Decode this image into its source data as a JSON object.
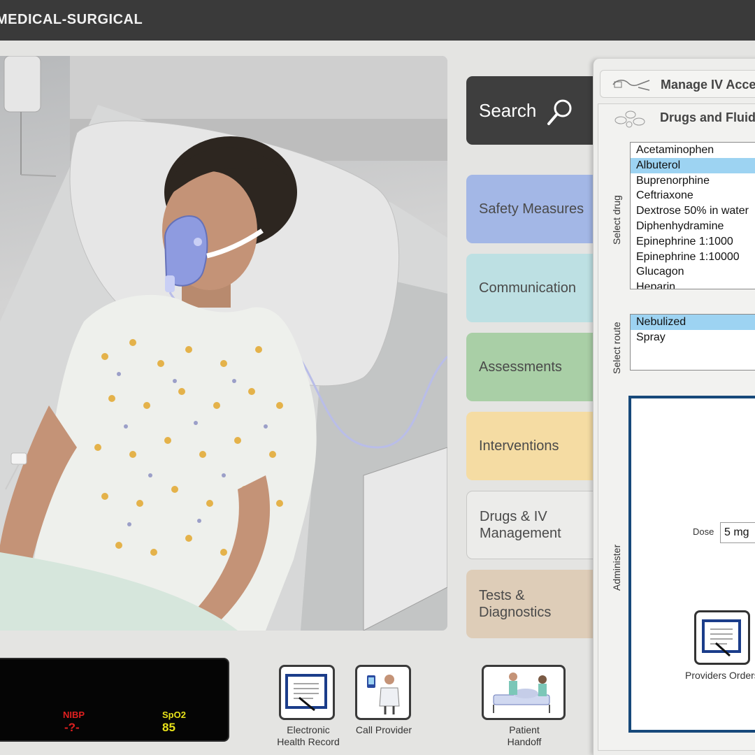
{
  "header": {
    "title": "MEDICAL-SURGICAL"
  },
  "nav": {
    "search_label": "Search",
    "tabs": [
      {
        "label": "Safety Measures",
        "color": "#a3b7e6"
      },
      {
        "label": "Communication",
        "color": "#bde0e3"
      },
      {
        "label": "Assessments",
        "color": "#a9cfa6"
      },
      {
        "label": "Interventions",
        "color": "#f5dca3"
      },
      {
        "label": "Drugs & IV\nManagement",
        "color": "#ececea"
      },
      {
        "label": "Tests &\nDiagnostics",
        "color": "#decdb8"
      }
    ]
  },
  "panel": {
    "manage_iv_label": "Manage IV Access",
    "drugs_fluids_label": "Drugs and Fluids",
    "select_drug_label": "Select drug",
    "drugs": [
      "Acetaminophen",
      "Albuterol",
      "Buprenorphine",
      "Ceftriaxone",
      "Dextrose 50% in water",
      "Diphenhydramine",
      "Epinephrine 1:1000",
      "Epinephrine 1:10000",
      "Glucagon",
      "Heparin"
    ],
    "selected_drug": "Albuterol",
    "select_route_label": "Select route",
    "routes": [
      "Nebulized",
      "Spray"
    ],
    "selected_route": "Nebulized",
    "administer_label": "Administer",
    "dose_label": "Dose",
    "dose_value": "5 mg",
    "providers_orders_label": "Providers Orders"
  },
  "toolbar": {
    "ehr_label": "Electronic\nHealth Record",
    "call_provider_label": "Call Provider",
    "handoff_label": "Patient\nHandoff"
  },
  "monitor": {
    "nibp_label": "NIBP",
    "nibp_value": "-?-",
    "nibp_color": "#e02020",
    "spo2_label": "SpO2",
    "spo2_value": "85",
    "spo2_color": "#e8e21a"
  }
}
